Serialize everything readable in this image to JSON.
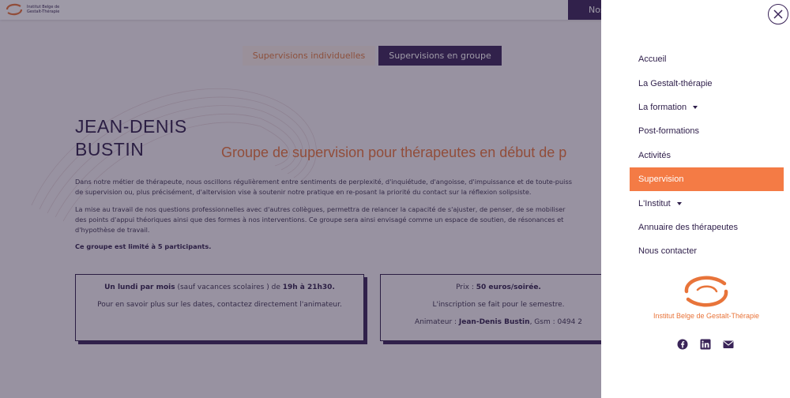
{
  "header": {
    "logo_line1": "Institut Belge de",
    "logo_line2": "Gestalt-Thérapie",
    "nav_button": "Nos"
  },
  "tabs": [
    {
      "label": "Supervisions individuelles"
    },
    {
      "label": "Supervisions en groupe"
    }
  ],
  "author": {
    "first": "JEAN-DENIS",
    "last": "BUSTIN"
  },
  "subtitle": "Groupe de supervision pour thérapeutes en début de p",
  "paragraphs": {
    "p1_l1": "Dans notre métier de thérapeute, nous oscillons régulièrement entre sentiments de perplexité, d'inquiétude, d'angoisse, d'impuissance et de toute-puiss",
    "p1_l2": "de supervision ou, plus précisément, d'altervision vise à soutenir notre pratique en re-posant la priorité du contact sur la réflexion solipsiste.",
    "p2_l1": "La mise au travail de nos questions professionnelles avec d'autres collègues, permettra de relancer la capacité de s'ajuster, de penser, de se mobiliser",
    "p2_l2": "des points d'appui théoriques ainsi que des formes à nos interventions. Ce groupe sera ainsi envisagé comme un espace de soutien, de résonances et",
    "p2_l3": "d'hypothèse de travail.",
    "p3": "Ce groupe est limité à 5 participants."
  },
  "card1": {
    "bold1": "Un lundi par mois",
    "text1": " (sauf vacances scolaires ) de ",
    "bold2": "19h à 21h30.",
    "line2": "Pour en savoir plus sur les dates, contactez directement l'animateur."
  },
  "card2": {
    "price_label": "Prix : ",
    "price_value": "50 euros/soirée.",
    "line2": "L'inscription se fait pour le semestre.",
    "anim_label": "Animateur : ",
    "anim_name": "Jean-Denis Bustin",
    "anim_rest": ", Gsm : 0494 2"
  },
  "menu": {
    "items": [
      {
        "label": "Accueil"
      },
      {
        "label": "La Gestalt-thérapie"
      },
      {
        "label": "La formation"
      },
      {
        "label": "Post-formations"
      },
      {
        "label": "Activités"
      },
      {
        "label": "Supervision"
      },
      {
        "label": "L'Institut"
      },
      {
        "label": "Annuaire des thérapeutes"
      },
      {
        "label": "Nous contacter"
      }
    ]
  },
  "panel_logo": {
    "text": "Institut Belge de Gestalt-Thérapie"
  },
  "icons": {
    "close": "close-icon",
    "facebook": "facebook-icon",
    "linkedin": "linkedin-icon",
    "email": "email-icon"
  },
  "colors": {
    "accent": "#f47b45",
    "brand": "#3a2458",
    "text": "#2e1e4a"
  }
}
